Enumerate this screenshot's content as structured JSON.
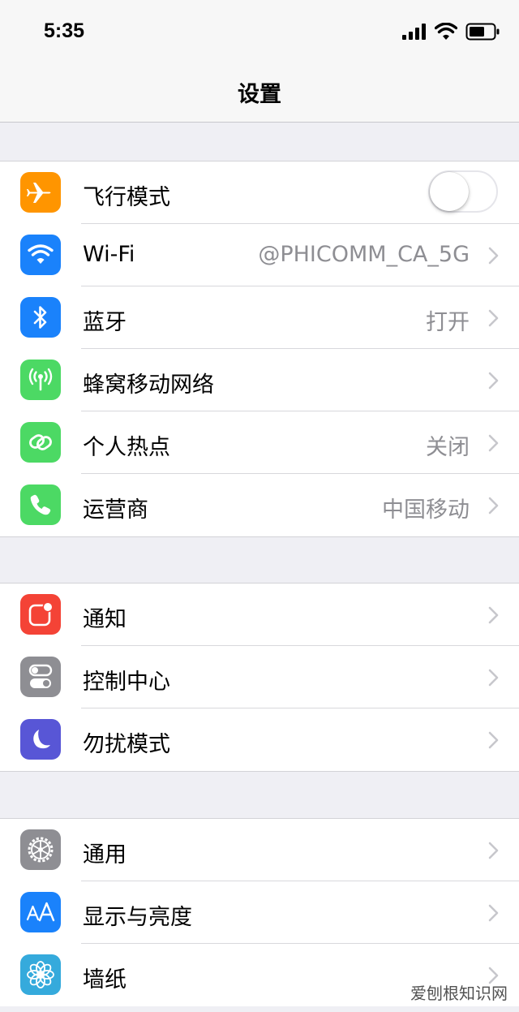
{
  "status_bar": {
    "time": "5:35"
  },
  "nav": {
    "title": "设置"
  },
  "groups": [
    {
      "items": [
        {
          "label": "飞行模式",
          "icon": "airplane-icon",
          "color": "#ff9500",
          "toggle": false
        },
        {
          "label": "Wi-Fi",
          "value": "@PHICOMM_CA_5G",
          "icon": "wifi-icon",
          "color": "#1a82fb"
        },
        {
          "label": "蓝牙",
          "value": "打开",
          "icon": "bluetooth-icon",
          "color": "#1a82fb"
        },
        {
          "label": "蜂窝移动网络",
          "value": "",
          "icon": "cellular-icon",
          "color": "#4cd964"
        },
        {
          "label": "个人热点",
          "value": "关闭",
          "icon": "hotspot-icon",
          "color": "#4cd964"
        },
        {
          "label": "运营商",
          "value": "中国移动",
          "icon": "phone-icon",
          "color": "#4cd964"
        }
      ]
    },
    {
      "items": [
        {
          "label": "通知",
          "value": "",
          "icon": "notifications-icon",
          "color": "#f44336"
        },
        {
          "label": "控制中心",
          "value": "",
          "icon": "control-center-icon",
          "color": "#8e8e93"
        },
        {
          "label": "勿扰模式",
          "value": "",
          "icon": "moon-icon",
          "color": "#5856d6"
        }
      ]
    },
    {
      "items": [
        {
          "label": "通用",
          "value": "",
          "icon": "gear-icon",
          "color": "#8e8e93"
        },
        {
          "label": "显示与亮度",
          "value": "",
          "icon": "display-brightness-icon",
          "color": "#1a82fb"
        },
        {
          "label": "墙纸",
          "value": "",
          "icon": "wallpaper-flower-icon",
          "color": "#35aadc"
        }
      ]
    }
  ],
  "watermark": "爱刨根知识网"
}
